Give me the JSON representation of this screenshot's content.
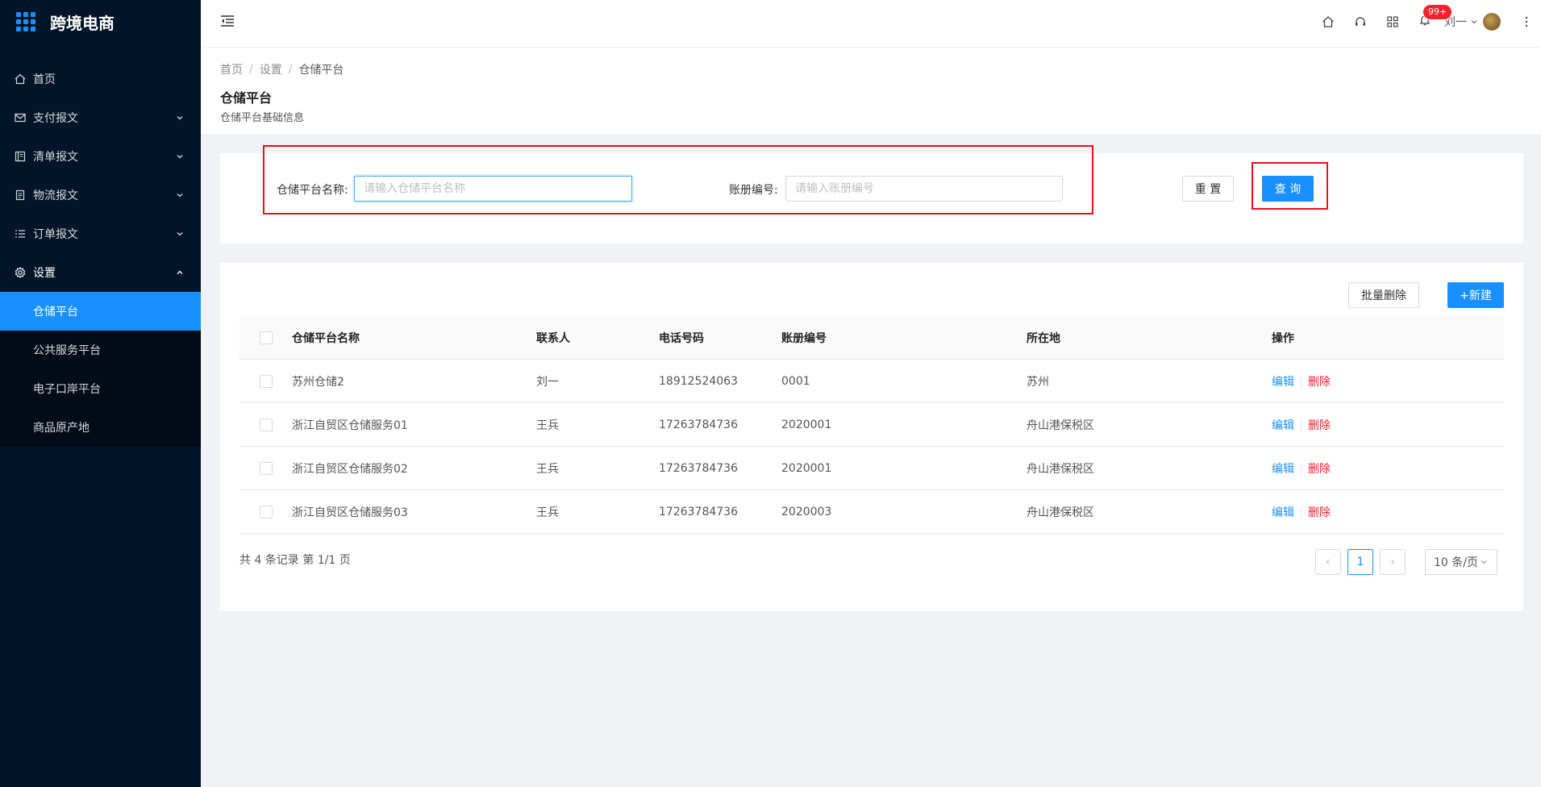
{
  "app": {
    "title": "跨境电商"
  },
  "sidebar": {
    "items": [
      {
        "label": "首页",
        "icon": "home-icon"
      },
      {
        "label": "支付报文",
        "icon": "mail-icon"
      },
      {
        "label": "清单报文",
        "icon": "profile-icon"
      },
      {
        "label": "物流报文",
        "icon": "container-icon"
      },
      {
        "label": "订单报文",
        "icon": "ordered-list-icon"
      },
      {
        "label": "设置",
        "icon": "setting-icon"
      }
    ],
    "submenu": [
      {
        "label": "仓储平台"
      },
      {
        "label": "公共服务平台"
      },
      {
        "label": "电子口岸平台"
      },
      {
        "label": "商品原产地"
      }
    ]
  },
  "header": {
    "notification_count": "99+",
    "user_name": "刘一"
  },
  "breadcrumb": {
    "home": "首页",
    "settings": "设置",
    "current": "仓储平台"
  },
  "page": {
    "title": "仓储平台",
    "subtitle": "仓储平台基础信息"
  },
  "filter": {
    "name_label": "仓储平台名称:",
    "name_placeholder": "请输入仓储平台名称",
    "account_label": "账册编号:",
    "account_placeholder": "请输入账册编号",
    "reset_label": "重 置",
    "query_label": "查 询"
  },
  "toolbar": {
    "batch_delete_label": "批量删除",
    "new_label": "+新建"
  },
  "table": {
    "columns": [
      "仓储平台名称",
      "联系人",
      "电话号码",
      "账册编号",
      "所在地",
      "操作"
    ],
    "rows": [
      {
        "name": "苏州仓储2",
        "contact": "刘一",
        "phone": "18912524063",
        "account": "0001",
        "location": "苏州"
      },
      {
        "name": "浙江自贸区仓储服务01",
        "contact": "王兵",
        "phone": "17263784736",
        "account": "2020001",
        "location": "舟山港保税区"
      },
      {
        "name": "浙江自贸区仓储服务02",
        "contact": "王兵",
        "phone": "17263784736",
        "account": "2020001",
        "location": "舟山港保税区"
      },
      {
        "name": "浙江自贸区仓储服务03",
        "contact": "王兵",
        "phone": "17263784736",
        "account": "2020003",
        "location": "舟山港保税区"
      }
    ],
    "edit_label": "编辑",
    "delete_label": "删除"
  },
  "pagination": {
    "summary": "共 4 条记录 第 1/1 页",
    "current_page": "1",
    "page_size": "10 条/页"
  },
  "colors": {
    "primary": "#1890ff",
    "sidebar_bg": "#001529",
    "danger": "#f5222d",
    "highlight_box": "#e8101c"
  }
}
